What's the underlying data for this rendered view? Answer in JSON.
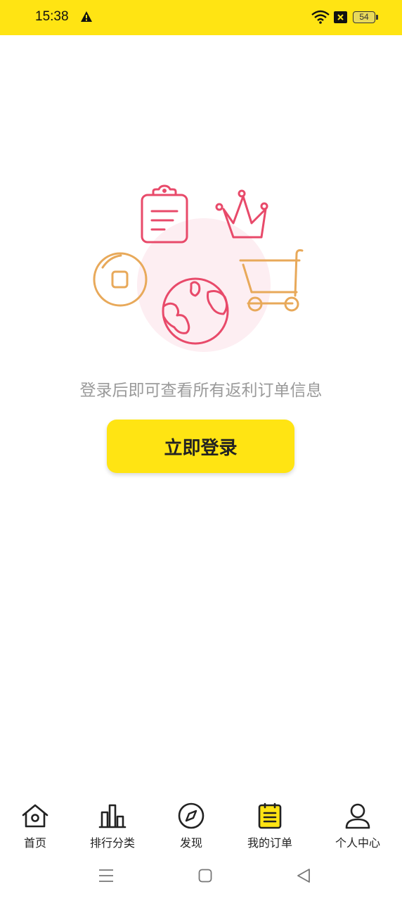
{
  "status_bar": {
    "time": "15:38",
    "battery_level": "54",
    "icons": [
      "warning-icon",
      "wifi-icon",
      "close-box-icon",
      "battery-icon"
    ]
  },
  "colors": {
    "accent_yellow": "#ffe413",
    "illustration_red": "#e84a6a",
    "illustration_orange": "#e8a95a"
  },
  "main": {
    "tip": "登录后即可查看所有返利订单信息",
    "login_button": "立即登录"
  },
  "tabs": [
    {
      "label": "首页",
      "icon": "home-icon"
    },
    {
      "label": "排行分类",
      "icon": "bar-chart-icon"
    },
    {
      "label": "发现",
      "icon": "compass-icon"
    },
    {
      "label": "我的订单",
      "icon": "clipboard-icon",
      "active": true
    },
    {
      "label": "个人中心",
      "icon": "person-icon"
    }
  ],
  "system_nav": [
    "menu-icon",
    "home-square-icon",
    "back-triangle-icon"
  ]
}
